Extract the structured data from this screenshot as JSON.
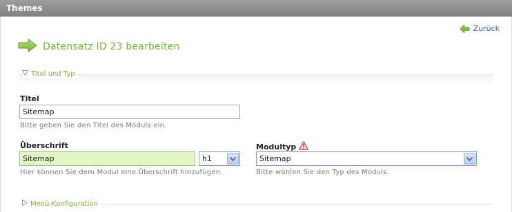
{
  "window": {
    "title": "Themes"
  },
  "nav": {
    "back_label": "Zurück"
  },
  "page": {
    "heading": "Datensatz ID 23 bearbeiten"
  },
  "sections": {
    "titel_typ": {
      "legend": "Titel und Typ",
      "state": "expanded"
    },
    "menu_config": {
      "legend": "Menü-Konfiguration",
      "state": "collapsed"
    }
  },
  "fields": {
    "titel": {
      "label": "Titel",
      "value": "Sitemap",
      "hint": "Bitte geben Sie den Titel des Moduls ein."
    },
    "ueberschrift": {
      "label": "Überschrift",
      "value": "Sitemap",
      "level_value": "h1",
      "hint": "Hier können Sie dem Modul eine Überschrift hinzufügen."
    },
    "modultyp": {
      "label": "Modultyp",
      "value": "Sitemap",
      "hint": "Bitte wählen Sie den Typ des Moduls.",
      "warning_icon": "warning-triangle-icon"
    }
  },
  "colors": {
    "accent_green": "#76b33a",
    "titlebar": "#8f8f8f",
    "input_highlight": "#e3f7c6"
  }
}
